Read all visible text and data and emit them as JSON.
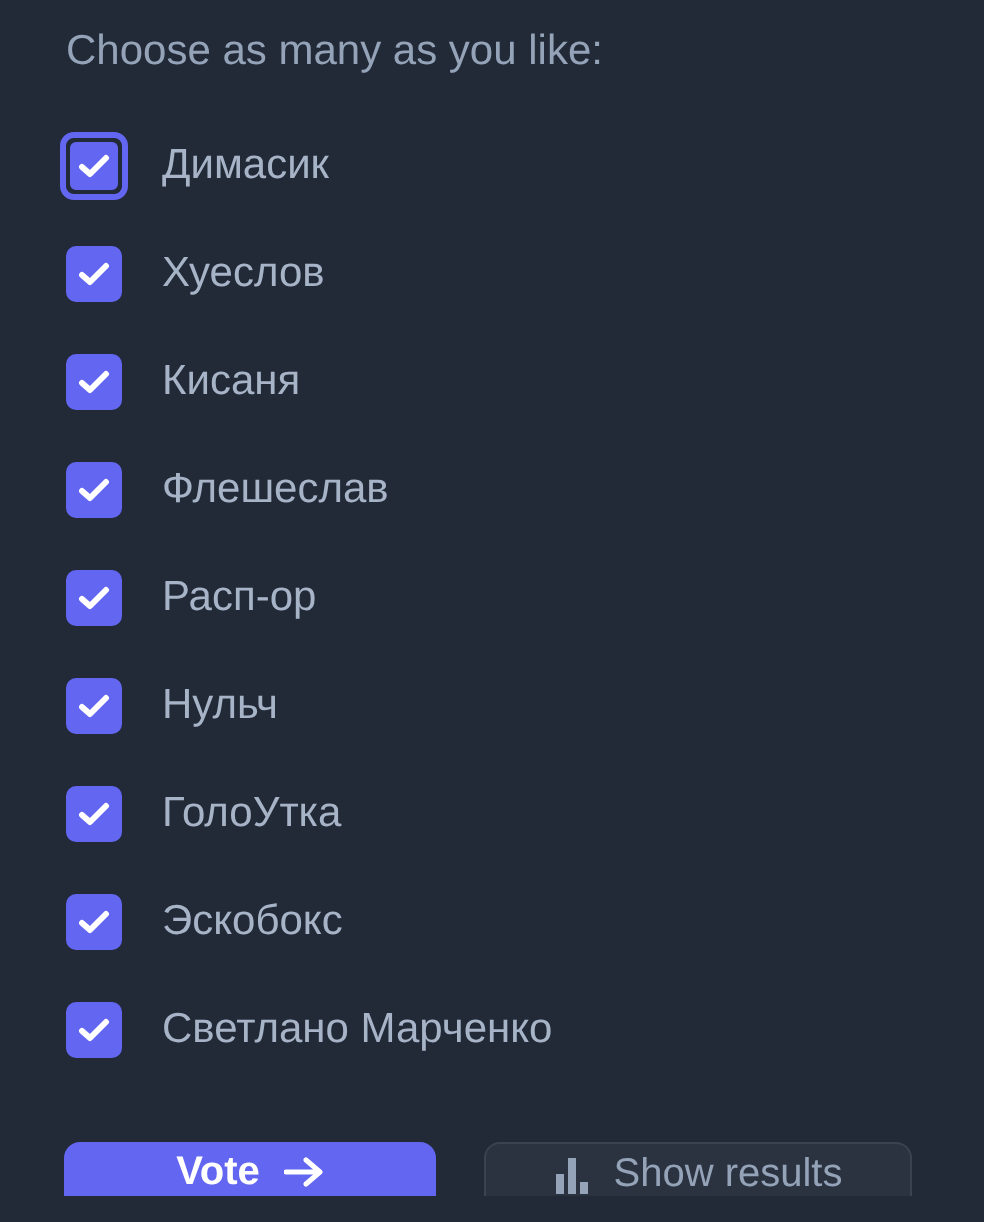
{
  "prompt": "Choose as many as you like:",
  "options": [
    {
      "label": "Димасик",
      "checked": true,
      "focused": true
    },
    {
      "label": "Хуеслов",
      "checked": true,
      "focused": false
    },
    {
      "label": "Кисаня",
      "checked": true,
      "focused": false
    },
    {
      "label": "Флешеслав",
      "checked": true,
      "focused": false
    },
    {
      "label": "Расп-ор",
      "checked": true,
      "focused": false
    },
    {
      "label": "Нульч",
      "checked": true,
      "focused": false
    },
    {
      "label": "ГолоУтка",
      "checked": true,
      "focused": false
    },
    {
      "label": "Эскобокс",
      "checked": true,
      "focused": false
    },
    {
      "label": "Светлано Марченко",
      "checked": true,
      "focused": false
    }
  ],
  "buttons": {
    "vote": "Vote",
    "results": "Show results"
  }
}
